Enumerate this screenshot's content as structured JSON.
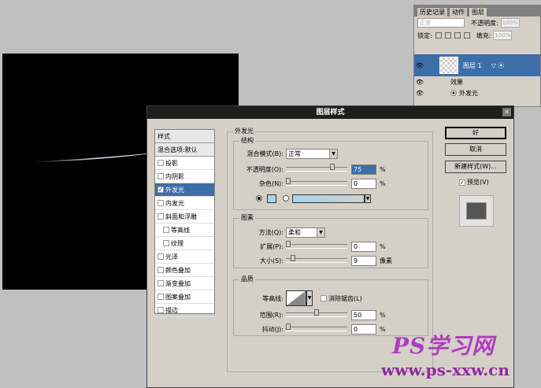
{
  "layers_panel": {
    "tabs": [
      "历史记录",
      "动作",
      "图层"
    ],
    "blend_mode": "正常",
    "opacity_label": "不透明度:",
    "opacity_value": "100%",
    "lock_label": "锁定:",
    "fill_label": "填充:",
    "fill_value": "100%",
    "layer_name": "图层 1",
    "effects_label": "效果",
    "effect_item": "外发光"
  },
  "dialog": {
    "title": "图层样式",
    "styles": [
      {
        "label": "样式",
        "checkbox": false,
        "checked": false,
        "selected": false,
        "indent": false,
        "header": true
      },
      {
        "label": "混合选项:默认",
        "checkbox": false,
        "checked": false,
        "selected": false,
        "indent": false,
        "header": true
      },
      {
        "label": "投影",
        "checkbox": true,
        "checked": false,
        "selected": false,
        "indent": false
      },
      {
        "label": "内阴影",
        "checkbox": true,
        "checked": false,
        "selected": false,
        "indent": false
      },
      {
        "label": "外发光",
        "checkbox": true,
        "checked": true,
        "selected": true,
        "indent": false
      },
      {
        "label": "内发光",
        "checkbox": true,
        "checked": false,
        "selected": false,
        "indent": false
      },
      {
        "label": "斜面和浮雕",
        "checkbox": true,
        "checked": false,
        "selected": false,
        "indent": false
      },
      {
        "label": "等高线",
        "checkbox": true,
        "checked": false,
        "selected": false,
        "indent": true
      },
      {
        "label": "纹理",
        "checkbox": true,
        "checked": false,
        "selected": false,
        "indent": true
      },
      {
        "label": "光泽",
        "checkbox": true,
        "checked": false,
        "selected": false,
        "indent": false
      },
      {
        "label": "颜色叠加",
        "checkbox": true,
        "checked": false,
        "selected": false,
        "indent": false
      },
      {
        "label": "渐变叠加",
        "checkbox": true,
        "checked": false,
        "selected": false,
        "indent": false
      },
      {
        "label": "图案叠加",
        "checkbox": true,
        "checked": false,
        "selected": false,
        "indent": false
      },
      {
        "label": "描边",
        "checkbox": true,
        "checked": false,
        "selected": false,
        "indent": false
      }
    ],
    "outer_glow_title": "外发光",
    "structure": {
      "title": "结构",
      "blend_label": "混合模式(B):",
      "blend_value": "正常",
      "opacity_label": "不透明度(O):",
      "opacity_value": "75",
      "noise_label": "杂色(N):",
      "noise_value": "0",
      "percent": "%"
    },
    "elements": {
      "title": "图素",
      "method_label": "方法(Q):",
      "method_value": "柔和",
      "spread_label": "扩展(P):",
      "spread_value": "0",
      "size_label": "大小(S):",
      "size_value": "9",
      "percent": "%",
      "px": "像素"
    },
    "quality": {
      "title": "品质",
      "contour_label": "等高线:",
      "antialias_label": "消除锯齿(L)",
      "range_label": "范围(R):",
      "range_value": "50",
      "jitter_label": "抖动(J):",
      "jitter_value": "0",
      "percent": "%"
    },
    "buttons": {
      "ok": "好",
      "cancel": "取消",
      "new_style": "新建样式(W)...",
      "preview": "预览(V)"
    },
    "glow_color": "#a8d4ee"
  },
  "watermark": {
    "line1": "PS学习网",
    "line2": "www.ps-xxw.cn"
  }
}
